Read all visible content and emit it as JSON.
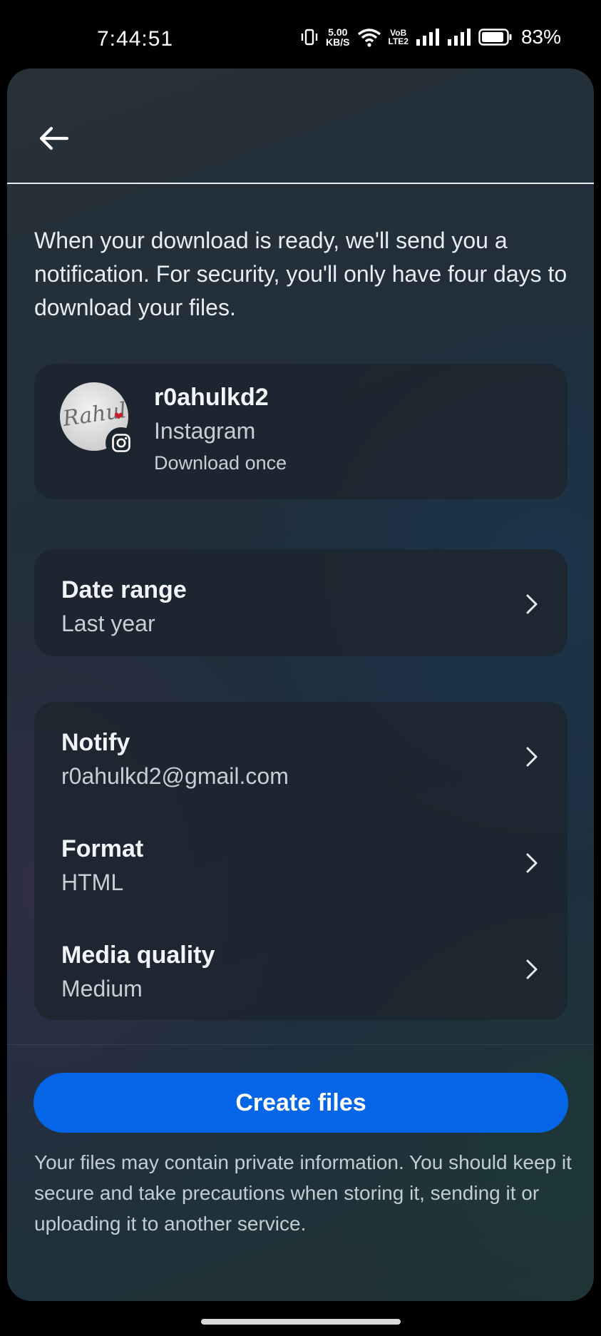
{
  "status_bar": {
    "time": "7:44:51",
    "net_speed_value": "5.00",
    "net_speed_unit": "KB/S",
    "volte_top": "VoB",
    "volte_bottom": "LTE2",
    "battery": "83%"
  },
  "intro_text": "When your download is ready, we'll send you a notification. For security, you'll only have four days to download your files.",
  "account": {
    "username": "r0ahulkd2",
    "platform": "Instagram",
    "download_mode": "Download once",
    "avatar_script": "Rahul"
  },
  "date_range": {
    "title": "Date range",
    "value": "Last year"
  },
  "settings": [
    {
      "title": "Notify",
      "value": "r0ahulkd2@gmail.com"
    },
    {
      "title": "Format",
      "value": "HTML"
    },
    {
      "title": "Media quality",
      "value": "Medium"
    }
  ],
  "create_button": "Create files",
  "disclaimer": "Your files may contain private information. You should keep it secure and take precautions when storing it, sending it or uploading it to another service.",
  "colors": {
    "accent": "#0466e6",
    "card": "#1c262f",
    "text_primary": "#f2f5f8",
    "text_secondary": "#c6ced6"
  }
}
